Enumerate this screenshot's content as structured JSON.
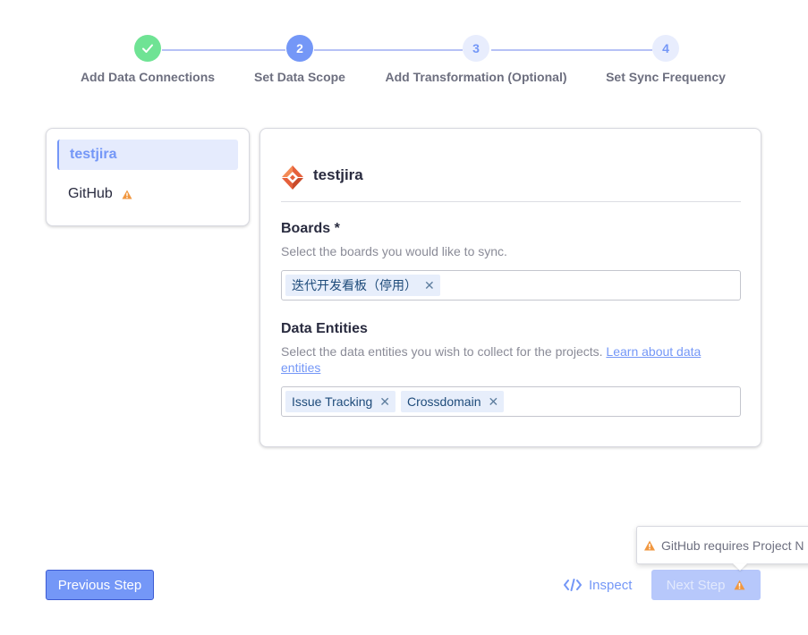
{
  "stepper": {
    "steps": [
      {
        "number": "",
        "label": "Add Data Connections",
        "status": "done"
      },
      {
        "number": "2",
        "label": "Set Data Scope",
        "status": "active"
      },
      {
        "number": "3",
        "label": "Add Transformation (Optional)",
        "status": "pending"
      },
      {
        "number": "4",
        "label": "Set Sync Frequency",
        "status": "pending"
      }
    ]
  },
  "sidebar": {
    "items": [
      {
        "label": "testjira",
        "active": true,
        "warning": false
      },
      {
        "label": "GitHub",
        "active": false,
        "warning": true
      }
    ]
  },
  "card": {
    "title": "testjira",
    "boards": {
      "title": "Boards *",
      "description": "Select the boards you would like to sync.",
      "tags": [
        "迭代开发看板（停用）"
      ]
    },
    "entities": {
      "title": "Data Entities",
      "description": "Select the data entities you wish to collect for the projects.",
      "link_text": "Learn about data entities",
      "tags": [
        "Issue Tracking",
        "Crossdomain"
      ]
    }
  },
  "footer": {
    "previous_label": "Previous Step",
    "inspect_label": "Inspect",
    "next_label": "Next Step",
    "tooltip_text": "GitHub requires Project N"
  },
  "colors": {
    "accent": "#7497f7",
    "done": "#6fe394",
    "warning": "#f1973f"
  }
}
